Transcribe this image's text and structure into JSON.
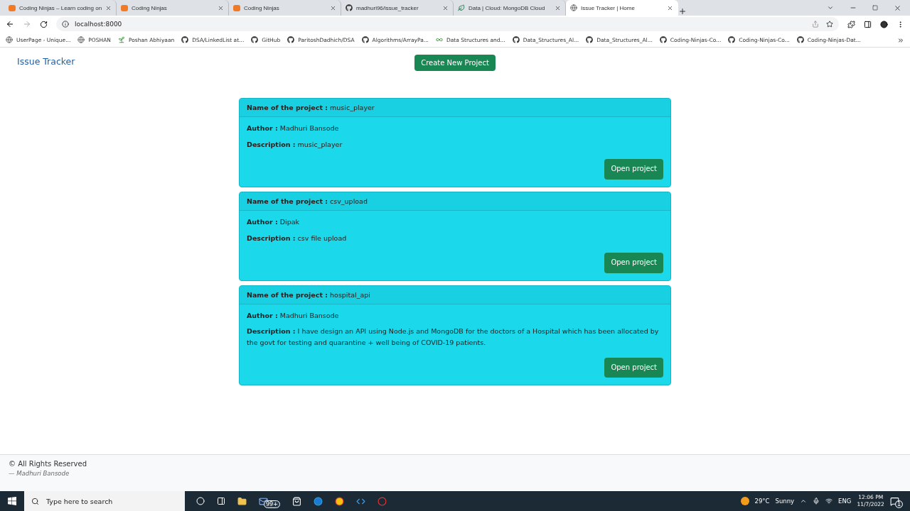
{
  "browser": {
    "tabs": [
      {
        "title": "Coding Ninjas – Learn coding on",
        "kind": "ninja",
        "selected": false
      },
      {
        "title": "Coding Ninjas",
        "kind": "ninja",
        "selected": false
      },
      {
        "title": "Coding Ninjas",
        "kind": "ninja",
        "selected": false
      },
      {
        "title": "madhuri96/issue_tracker",
        "kind": "github",
        "selected": false
      },
      {
        "title": "Data | Cloud: MongoDB Cloud",
        "kind": "leaf",
        "selected": false
      },
      {
        "title": "Issue Tracker | Home",
        "kind": "globe",
        "selected": true
      }
    ],
    "address": "localhost:8000",
    "bookmarks": [
      {
        "label": "UserPage - Unique...",
        "kind": "globe"
      },
      {
        "label": "POSHAN",
        "kind": "globe"
      },
      {
        "label": "Poshan Abhiyaan",
        "kind": "sprout"
      },
      {
        "label": "DSA/LinkedList at...",
        "kind": "github"
      },
      {
        "label": "GitHub",
        "kind": "github"
      },
      {
        "label": "ParitoshDadhich/DSA",
        "kind": "github"
      },
      {
        "label": "Algorithms/ArrayPa...",
        "kind": "github"
      },
      {
        "label": "Data Structures and...",
        "kind": "infinity"
      },
      {
        "label": "Data_Structures_Al...",
        "kind": "github"
      },
      {
        "label": "Data_Structures_Al...",
        "kind": "github"
      },
      {
        "label": "Coding-Ninjas-Co...",
        "kind": "github"
      },
      {
        "label": "Coding-Ninjas-Co...",
        "kind": "github"
      },
      {
        "label": "Coding-Ninjas-Dat...",
        "kind": "github"
      }
    ]
  },
  "page": {
    "brand": "Issue Tracker",
    "create_button": "Create New Project",
    "projects": [
      {
        "name_line": "**Name of the project :** music_player",
        "author_line": "**Author :** Madhuri Bansode",
        "description_line": "**Description :** music_player",
        "button": "Open project"
      },
      {
        "name_line": "**Name of the project :** csv_upload",
        "author_line": "**Author :** Dipak",
        "description_line": "**Description :** csv file upload",
        "button": "Open project"
      },
      {
        "name_line": "**Name of the project :** hospital_api",
        "author_line": "**Author :** Madhuri Bansode",
        "description_line": "**Description :** I have design an API using Node.js and MongoDB for the doctors of a Hospital which has been allocated by the govt for testing and quarantine + well being of COVID-19 patients.",
        "button": "Open project"
      }
    ],
    "footer": {
      "rights": "© All Rights Reserved",
      "credit": "— Madhuri Bansode"
    }
  },
  "taskbar": {
    "search_placeholder": "Type here to search",
    "mail_badge": "99+",
    "temperature": "29°C",
    "weather": "Sunny",
    "language": "ENG",
    "time": "12:06 PM",
    "date": "11/7/2022",
    "notifications": "1"
  }
}
